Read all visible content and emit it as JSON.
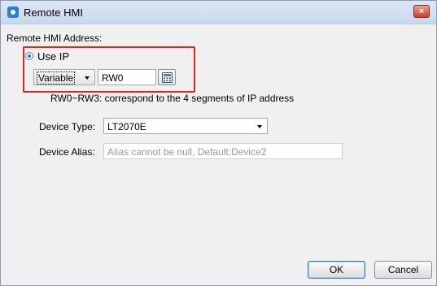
{
  "window": {
    "title": "Remote HMI",
    "close_glyph": "×"
  },
  "address": {
    "label": "Remote HMI Address:",
    "use_ip_label": "Use IP",
    "source_type_value": "Variable",
    "variable_value": "RW0",
    "hint": "RW0~RW3: correspond to the 4 segments of IP address"
  },
  "device_type": {
    "label": "Device Type:",
    "value": "LT2070E"
  },
  "device_alias": {
    "label": "Device Alias:",
    "placeholder": "Alias cannot be null, Default:Device2"
  },
  "buttons": {
    "ok": "OK",
    "cancel": "Cancel"
  },
  "icons": {
    "app": "app-icon",
    "close": "close-icon",
    "calculator": "calculator-icon",
    "dropdown": "chevron-down-icon"
  },
  "colors": {
    "highlight": "#e8261c",
    "title_bar": "#c9d9ee",
    "close_button": "#c9412a"
  }
}
